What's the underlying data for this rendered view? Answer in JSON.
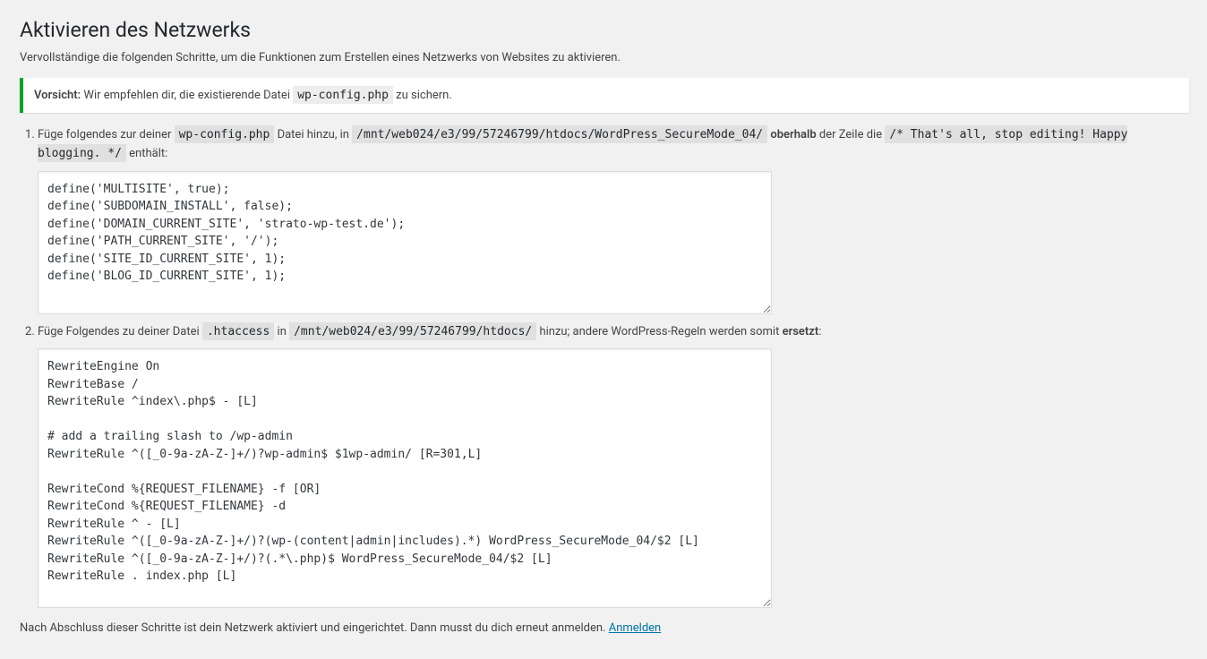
{
  "heading": "Aktivieren des Netzwerks",
  "intro": "Vervollständige die folgenden Schritte, um die Funktionen zum Erstellen eines Netzwerks von Websites zu aktivieren.",
  "notice": {
    "strong": "Vorsicht:",
    "text_before": " Wir empfehlen dir, die existierende Datei ",
    "code": "wp-config.php",
    "text_after": " zu sichern."
  },
  "step1": {
    "text1": "Füge folgendes zur deiner ",
    "code1": "wp-config.php",
    "text2": " Datei hinzu, in ",
    "code2": "/mnt/web024/e3/99/57246799/htdocs/WordPress_SecureMode_04/",
    "text3": " ",
    "strong1": "oberhalb",
    "text4": " der Zeile die ",
    "code3": "/* That's all, stop editing! Happy blogging. */",
    "text5": " enthält:",
    "textarea": "define('MULTISITE', true);\ndefine('SUBDOMAIN_INSTALL', false);\ndefine('DOMAIN_CURRENT_SITE', 'strato-wp-test.de');\ndefine('PATH_CURRENT_SITE', '/');\ndefine('SITE_ID_CURRENT_SITE', 1);\ndefine('BLOG_ID_CURRENT_SITE', 1);"
  },
  "step2": {
    "text1": "Füge Folgendes zu deiner Datei ",
    "code1": ".htaccess",
    "text2": " in ",
    "code2": "/mnt/web024/e3/99/57246799/htdocs/",
    "text3": " hinzu; andere WordPress-Regeln werden somit ",
    "strong1": "ersetzt",
    "text4": ":",
    "textarea": "RewriteEngine On\nRewriteBase /\nRewriteRule ^index\\.php$ - [L]\n\n# add a trailing slash to /wp-admin\nRewriteRule ^([_0-9a-zA-Z-]+/)?wp-admin$ $1wp-admin/ [R=301,L]\n\nRewriteCond %{REQUEST_FILENAME} -f [OR]\nRewriteCond %{REQUEST_FILENAME} -d\nRewriteRule ^ - [L]\nRewriteRule ^([_0-9a-zA-Z-]+/)?(wp-(content|admin|includes).*) WordPress_SecureMode_04/$2 [L]\nRewriteRule ^([_0-9a-zA-Z-]+/)?(.*\\.php)$ WordPress_SecureMode_04/$2 [L]\nRewriteRule . index.php [L]"
  },
  "footer": {
    "text": "Nach Abschluss dieser Schritte ist dein Netzwerk aktiviert und eingerichtet. Dann musst du dich erneut anmelden. ",
    "link": "Anmelden"
  }
}
